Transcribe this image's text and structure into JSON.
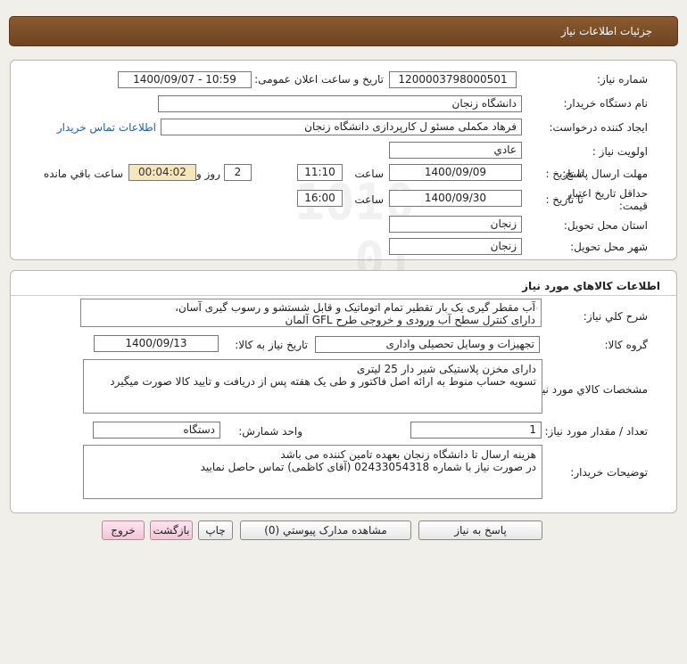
{
  "header": {
    "title": "جزئیات اطلاعات نیاز"
  },
  "details": {
    "need_number_label": "شماره نیاز:",
    "need_number": "1200003798000501",
    "announce_label": "تاریخ و ساعت اعلان عمومی:",
    "announce_value": "1400/09/07 - 10:59",
    "buyer_org_label": "نام دستگاه خریدار:",
    "buyer_org": "دانشگاه زنجان",
    "requester_label": "ایجاد کننده درخواست:",
    "requester": "فرهاد مکملی مسئو ل کارپردازی دانشگاه زنجان",
    "contact_link": "اطلاعات تماس خریدار",
    "priority_label": "اولویت نیاز :",
    "priority": "عادي",
    "deadline_label": "مهلت ارسال پاسخ:",
    "until_date_label": "تا تاریخ :",
    "deadline_date": "1400/09/09",
    "time_label": "ساعت",
    "deadline_time": "11:10",
    "days_value": "2",
    "days_label": "روز و",
    "remaining_value": "00:04:02",
    "remaining_label": "ساعت باقي مانده",
    "validity_label_1": "حداقل تاریخ اعتبار",
    "validity_label_2": "قیمت:",
    "validity_until_label": "تا تاریخ :",
    "validity_date": "1400/09/30",
    "validity_time_label": "ساعت",
    "validity_time": "16:00",
    "province_label": "استان محل تحویل:",
    "province": "زنجان",
    "city_label": "شهر محل تحویل:",
    "city": "زنجان"
  },
  "goods": {
    "section_title": "اطلاعات کالاهاي مورد نياز",
    "summary_label": "شرح کلي نياز:",
    "summary_lines": [
      "آب مقطر گیری یک بار تقطیر تمام اتوماتیک و قابل شستشو و رسوب گیری آسان،",
      "دارای کنترل سطح آب ورودی و خروجی طرح GFL آلمان"
    ],
    "group_label": "گروه کالا:",
    "group_value": "تجهیزات و وسایل تحصیلی واداری",
    "need_date_label": "تاریخ نیاز به کالا:",
    "need_date": "1400/09/13",
    "spec_label": "مشخصات کالاي مورد نياز:",
    "spec_lines": [
      "دارای مخزن پلاستیکی شیر دار 25 لیتری",
      "تسویه حساب منوط به ارائه اصل فاکتور و طی یک هفته پس از دریافت و تایید کالا صورت میگیرد"
    ],
    "qty_label": "تعداد / مقدار مورد نیاز:",
    "qty_value": "1",
    "unit_label": "واحد شمارش:",
    "unit_value": "دستگاه",
    "buyer_notes_label": "توضیحات خریدار:",
    "buyer_notes_lines": [
      "هزینه ارسال تا دانشگاه زنجان بعهده تامین کننده می باشد",
      "در صورت نیاز با شماره 02433054318 (آقای کاظمی) تماس حاصل نمایید"
    ]
  },
  "buttons": {
    "reply": "پاسخ به نیاز",
    "attachments": "مشاهده مدارک پیوستي (0)",
    "print": "چاپ",
    "back": "بازگشت",
    "exit": "خروج"
  },
  "watermark": {
    "line1": "ParsNamadData",
    "line2": "مرکز فراوری اطلاعات پارس نماد داده",
    "line3": "پایگاه اطلاع رسانی مناقصه و مزایده",
    "phone": "۰۲۱-۸۸۳۴۹۶۷۰"
  }
}
